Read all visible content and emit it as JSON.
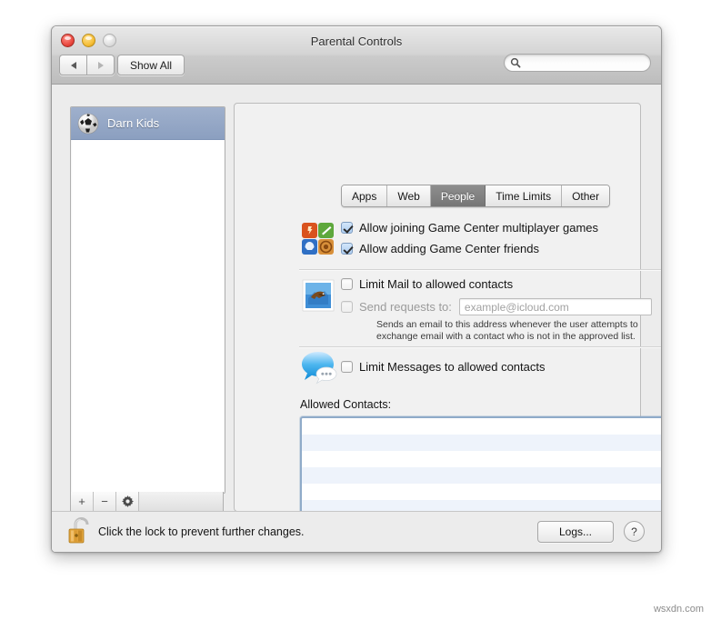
{
  "window": {
    "title": "Parental Controls",
    "traffic_lights": [
      "close",
      "minimize",
      "zoom"
    ],
    "toolbar": {
      "back_icon": "triangle-left-icon",
      "forward_icon": "triangle-right-icon",
      "show_all_label": "Show All",
      "search": {
        "icon": "search-icon",
        "value": "",
        "placeholder": ""
      }
    }
  },
  "sidebar": {
    "users": [
      {
        "name": "Darn Kids",
        "avatar_icon": "soccer-ball-avatar",
        "selected": true
      }
    ],
    "toolbar": {
      "add_label": "+",
      "remove_label": "−",
      "gear_icon": "gear-icon"
    }
  },
  "tabs": [
    {
      "label": "Apps",
      "active": false
    },
    {
      "label": "Web",
      "active": false
    },
    {
      "label": "People",
      "active": true
    },
    {
      "label": "Time Limits",
      "active": false
    },
    {
      "label": "Other",
      "active": false
    }
  ],
  "people_pane": {
    "game_center": {
      "icon": "game-center-icon",
      "options": [
        {
          "label": "Allow joining Game Center multiplayer games",
          "checked": true,
          "enabled": true
        },
        {
          "label": "Allow adding Game Center friends",
          "checked": true,
          "enabled": true
        }
      ]
    },
    "mail": {
      "icon": "mail-stamp-icon",
      "limit_label": "Limit Mail to allowed contacts",
      "limit_checked": false,
      "send_requests_label": "Send requests to:",
      "send_requests_checked": false,
      "send_requests_enabled": false,
      "email_value": "",
      "email_placeholder": "example@icloud.com",
      "help_line_1": "Sends an email to this address whenever the user attempts to",
      "help_line_2": "exchange email with a contact who is not in the approved list."
    },
    "messages": {
      "icon": "messages-bubble-icon",
      "limit_label": "Limit Messages to allowed contacts",
      "limit_checked": false
    },
    "allowed_contacts": {
      "label": "Allowed Contacts:",
      "items": [],
      "row_count": 7,
      "toolbar": {
        "add_label": "+",
        "remove_label": "−"
      }
    }
  },
  "footer": {
    "lock_icon": "unlocked-padlock-icon",
    "lock_text": "Click the lock to prevent further changes.",
    "logs_label": "Logs...",
    "help_label": "?"
  },
  "watermark": "wsxdn.com",
  "colors": {
    "selection_blue": "#9fb0cc",
    "active_tab_gray": "#7d7d7d",
    "focus_ring": "#8fabc9",
    "list_alt_row": "#eef3fb"
  }
}
